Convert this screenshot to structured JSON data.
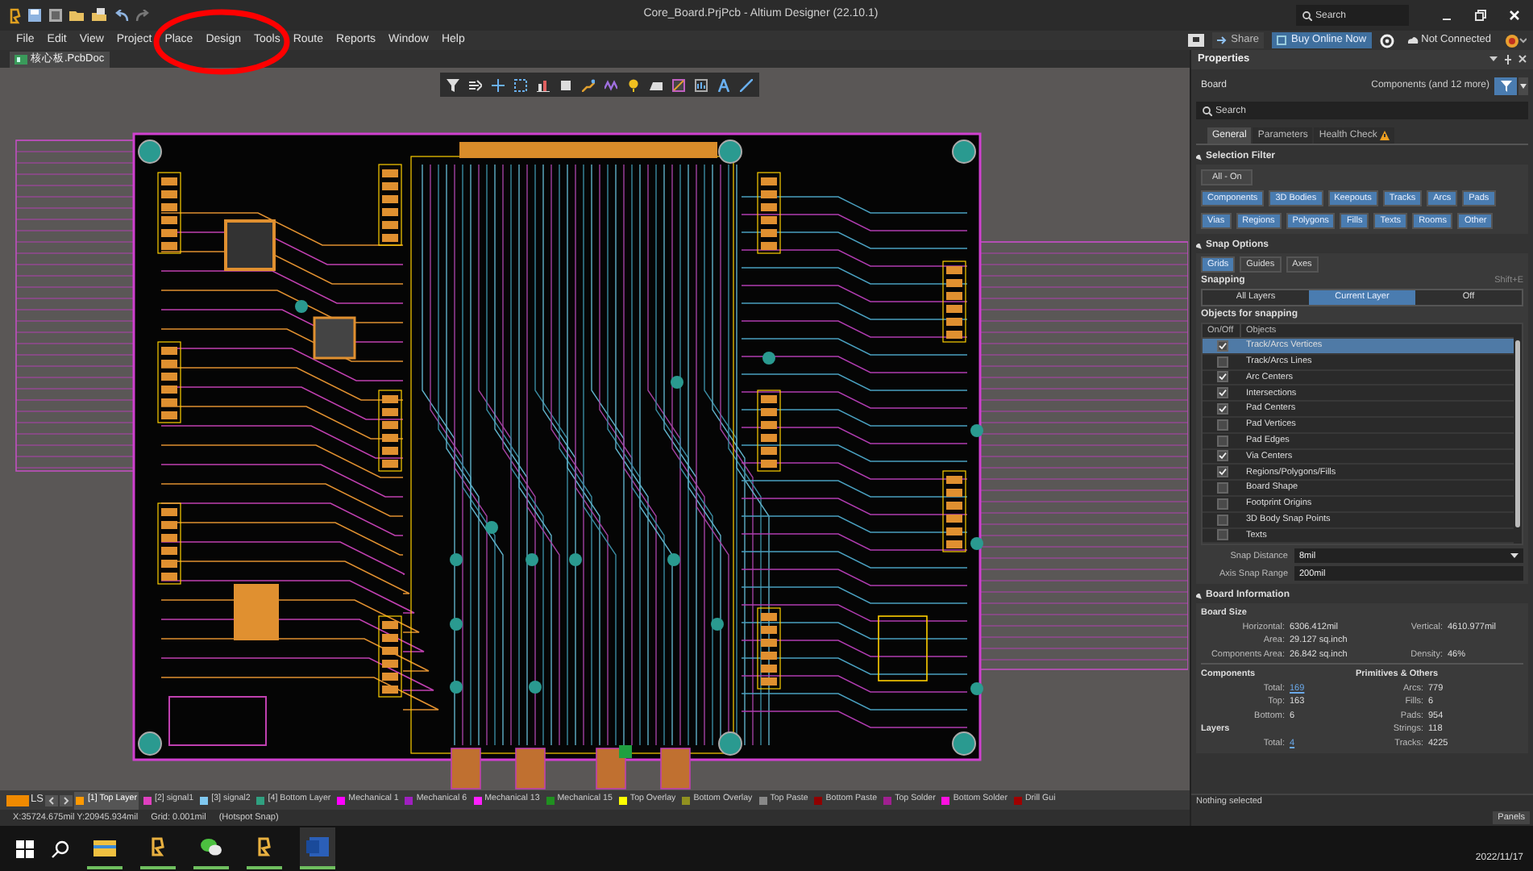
{
  "window": {
    "title": "Core_Board.PrjPcb - Altium Designer (22.10.1)",
    "search_placeholder": "Search"
  },
  "menu": [
    "File",
    "Edit",
    "View",
    "Project",
    "Place",
    "Design",
    "Tools",
    "Route",
    "Reports",
    "Window",
    "Help"
  ],
  "header_buttons": [
    {
      "label": "Share",
      "kind": "plain"
    },
    {
      "label": "Buy Online Now",
      "kind": "primary"
    },
    {
      "label": "Not Connected",
      "kind": "status"
    }
  ],
  "document_tabs": [
    {
      "label": "核心板.PcbDoc",
      "selected": true
    }
  ],
  "properties": {
    "title": "Properties",
    "object": "Board",
    "filter_summary": "Components (and 12 more)",
    "search_placeholder": "Search",
    "tabs": [
      {
        "label": "General",
        "selected": true,
        "warning": false
      },
      {
        "label": "Parameters",
        "selected": false,
        "warning": false
      },
      {
        "label": "Health Check",
        "selected": false,
        "warning": true
      }
    ],
    "selection_filter": {
      "title": "Selection Filter",
      "all_on": "All - On",
      "items": [
        {
          "label": "Components",
          "on": true
        },
        {
          "label": "3D Bodies",
          "on": true
        },
        {
          "label": "Keepouts",
          "on": true
        },
        {
          "label": "Tracks",
          "on": true
        },
        {
          "label": "Arcs",
          "on": true
        },
        {
          "label": "Pads",
          "on": true
        },
        {
          "label": "Vias",
          "on": true
        },
        {
          "label": "Regions",
          "on": true
        },
        {
          "label": "Polygons",
          "on": true
        },
        {
          "label": "Fills",
          "on": true
        },
        {
          "label": "Texts",
          "on": true
        },
        {
          "label": "Rooms",
          "on": true
        },
        {
          "label": "Other",
          "on": true
        }
      ]
    },
    "snap_options": {
      "title": "Snap Options",
      "modes": [
        {
          "label": "Grids",
          "on": true
        },
        {
          "label": "Guides",
          "on": false
        },
        {
          "label": "Axes",
          "on": false
        }
      ],
      "snapping_label": "Snapping",
      "shortcut": "Shift+E",
      "snapping": [
        {
          "label": "All Layers",
          "selected": false
        },
        {
          "label": "Current Layer",
          "selected": true
        },
        {
          "label": "Off",
          "selected": false
        }
      ],
      "objects_title": "Objects for snapping",
      "columns": [
        "On/Off",
        "Objects"
      ],
      "objects": [
        {
          "label": "Track/Arcs Vertices",
          "checked": true,
          "selected": true
        },
        {
          "label": "Track/Arcs Lines",
          "checked": false,
          "selected": false
        },
        {
          "label": "Arc Centers",
          "checked": true,
          "selected": false
        },
        {
          "label": "Intersections",
          "checked": true,
          "selected": false
        },
        {
          "label": "Pad Centers",
          "checked": true,
          "selected": false
        },
        {
          "label": "Pad Vertices",
          "checked": false,
          "selected": false
        },
        {
          "label": "Pad Edges",
          "checked": false,
          "selected": false
        },
        {
          "label": "Via Centers",
          "checked": true,
          "selected": false
        },
        {
          "label": "Regions/Polygons/Fills",
          "checked": true,
          "selected": false
        },
        {
          "label": "Board Shape",
          "checked": false,
          "selected": false
        },
        {
          "label": "Footprint Origins",
          "checked": false,
          "selected": false
        },
        {
          "label": "3D Body Snap Points",
          "checked": false,
          "selected": false
        },
        {
          "label": "Texts",
          "checked": false,
          "selected": false
        }
      ],
      "snap_distance": {
        "label": "Snap Distance",
        "value": "8mil"
      },
      "axis_snap_range": {
        "label": "Axis Snap Range",
        "value": "200mil"
      }
    },
    "board_information": {
      "title": "Board Information",
      "board_size_title": "Board Size",
      "board_size": [
        {
          "label": "Horizontal:",
          "value": "6306.412mil"
        },
        {
          "label": "Vertical:",
          "value": "4610.977mil"
        },
        {
          "label": "Area:",
          "value": "29.127 sq.inch"
        },
        {
          "label": "Components Area:",
          "value": "26.842 sq.inch"
        },
        {
          "label": "Density:",
          "value": "46%"
        }
      ],
      "components_title": "Components",
      "components": [
        {
          "label": "Total:",
          "value": "169",
          "link": true
        },
        {
          "label": "Top:",
          "value": "163",
          "link": false
        },
        {
          "label": "Bottom:",
          "value": "6",
          "link": false
        }
      ],
      "layers_title": "Layers",
      "layers": [
        {
          "label": "Total:",
          "value": "4",
          "link": true
        }
      ],
      "primitives_title": "Primitives & Others",
      "primitives": [
        {
          "label": "Arcs:",
          "value": "779"
        },
        {
          "label": "Fills:",
          "value": "6"
        },
        {
          "label": "Pads:",
          "value": "954"
        },
        {
          "label": "Strings:",
          "value": "118"
        },
        {
          "label": "Tracks:",
          "value": "4225"
        }
      ]
    },
    "selection_status": "Nothing selected",
    "panels_button": "Panels"
  },
  "layer_bar": {
    "label": "LS",
    "layers": [
      {
        "name": "[1] Top Layer",
        "color": "#ff9900",
        "selected": true
      },
      {
        "name": "[2] signal1",
        "color": "#e040c0",
        "selected": false
      },
      {
        "name": "[3] signal2",
        "color": "#80c8f0",
        "selected": false
      },
      {
        "name": "[4] Bottom Layer",
        "color": "#30a080",
        "selected": false
      },
      {
        "name": "Mechanical 1",
        "color": "#ff00ff",
        "selected": false
      },
      {
        "name": "Mechanical 6",
        "color": "#a020c0",
        "selected": false
      },
      {
        "name": "Mechanical 13",
        "color": "#ff20ff",
        "selected": false
      },
      {
        "name": "Mechanical 15",
        "color": "#209020",
        "selected": false
      },
      {
        "name": "Top Overlay",
        "color": "#ffff00",
        "selected": false
      },
      {
        "name": "Bottom Overlay",
        "color": "#909020",
        "selected": false
      },
      {
        "name": "Top Paste",
        "color": "#888888",
        "selected": false
      },
      {
        "name": "Bottom Paste",
        "color": "#900000",
        "selected": false
      },
      {
        "name": "Top Solder",
        "color": "#a02090",
        "selected": false
      },
      {
        "name": "Bottom Solder",
        "color": "#ff10e0",
        "selected": false
      },
      {
        "name": "Drill Gui",
        "color": "#a00000",
        "selected": false
      }
    ]
  },
  "status_bar": {
    "coordinates": "X:35724.675mil Y:20945.934mil",
    "grid": "Grid: 0.001mil",
    "snap": "(Hotspot Snap)"
  },
  "taskbar": {
    "date": "2022/11/17"
  }
}
